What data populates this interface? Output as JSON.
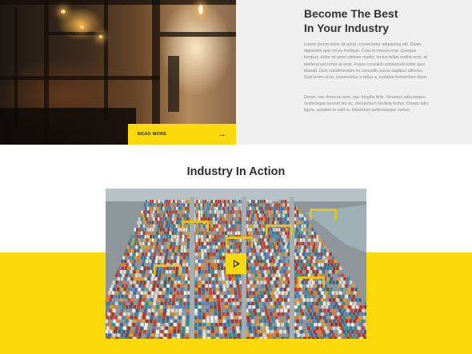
{
  "about": {
    "title_line1": "Become The Best",
    "title_line2": "In Your Industry",
    "paragraph1": "Lorem ipsum dolor sit amet, consectetur adipiscing elit. Etiam dignissim quis mi eu tristique. Cras et massa erat. Quisque tempus, dolor sit amet ultrices mattis, lectus tellus mattis eros, at eleifend est tortor at eros. Fusce convallis consequat tortor quis blandit. Duis condimentum ex convallis purus dapibus ultricies. Sed lorem urna, consectetur a tellus a, sodales fermentum diam.",
    "paragraph2": "Donec nec rhoncus sem, nec fringilla felis. Vivamus odio neque, scelerisque laoreet leo ac, elementum facilisis lectus. Donec odio ligula, sodales in velit in, bibendum pellentesque metus.",
    "read_more_label": "READ MORE",
    "read_more_icon": "arrow-right-icon"
  },
  "action": {
    "heading": "Industry In Action",
    "play_icon": "play-icon"
  },
  "colors": {
    "accent": "#fcd90a",
    "heading_text": "#333333",
    "body_text": "#8a8a8a",
    "panel_bg": "#efefef"
  }
}
